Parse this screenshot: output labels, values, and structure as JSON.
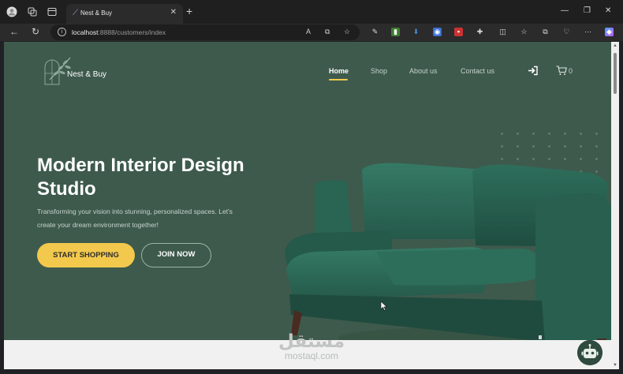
{
  "browser": {
    "tab_title": "Nest & Buy",
    "url_host": "localhost",
    "url_path": ":8888/customers/index"
  },
  "site": {
    "brand": "Nest & Buy",
    "nav": [
      {
        "label": "Home",
        "active": true
      },
      {
        "label": "Shop",
        "active": false
      },
      {
        "label": "About us",
        "active": false
      },
      {
        "label": "Contact us",
        "active": false
      }
    ],
    "cart_count": "0"
  },
  "hero": {
    "title_line1": "Modern Interior Design",
    "title_line2": "Studio",
    "subtitle_line1": "Transforming your vision into stunning, personalized spaces. Let's",
    "subtitle_line2": "create your dream environment together!",
    "primary_button": "START SHOPPING",
    "secondary_button": "JOIN NOW"
  },
  "watermark": {
    "arabic": "مستقل",
    "latin": "mostaql.com"
  },
  "colors": {
    "hero_bg": "#3e5a4d",
    "accent_yellow": "#f2c94c",
    "sofa_green": "#2f6a58"
  }
}
